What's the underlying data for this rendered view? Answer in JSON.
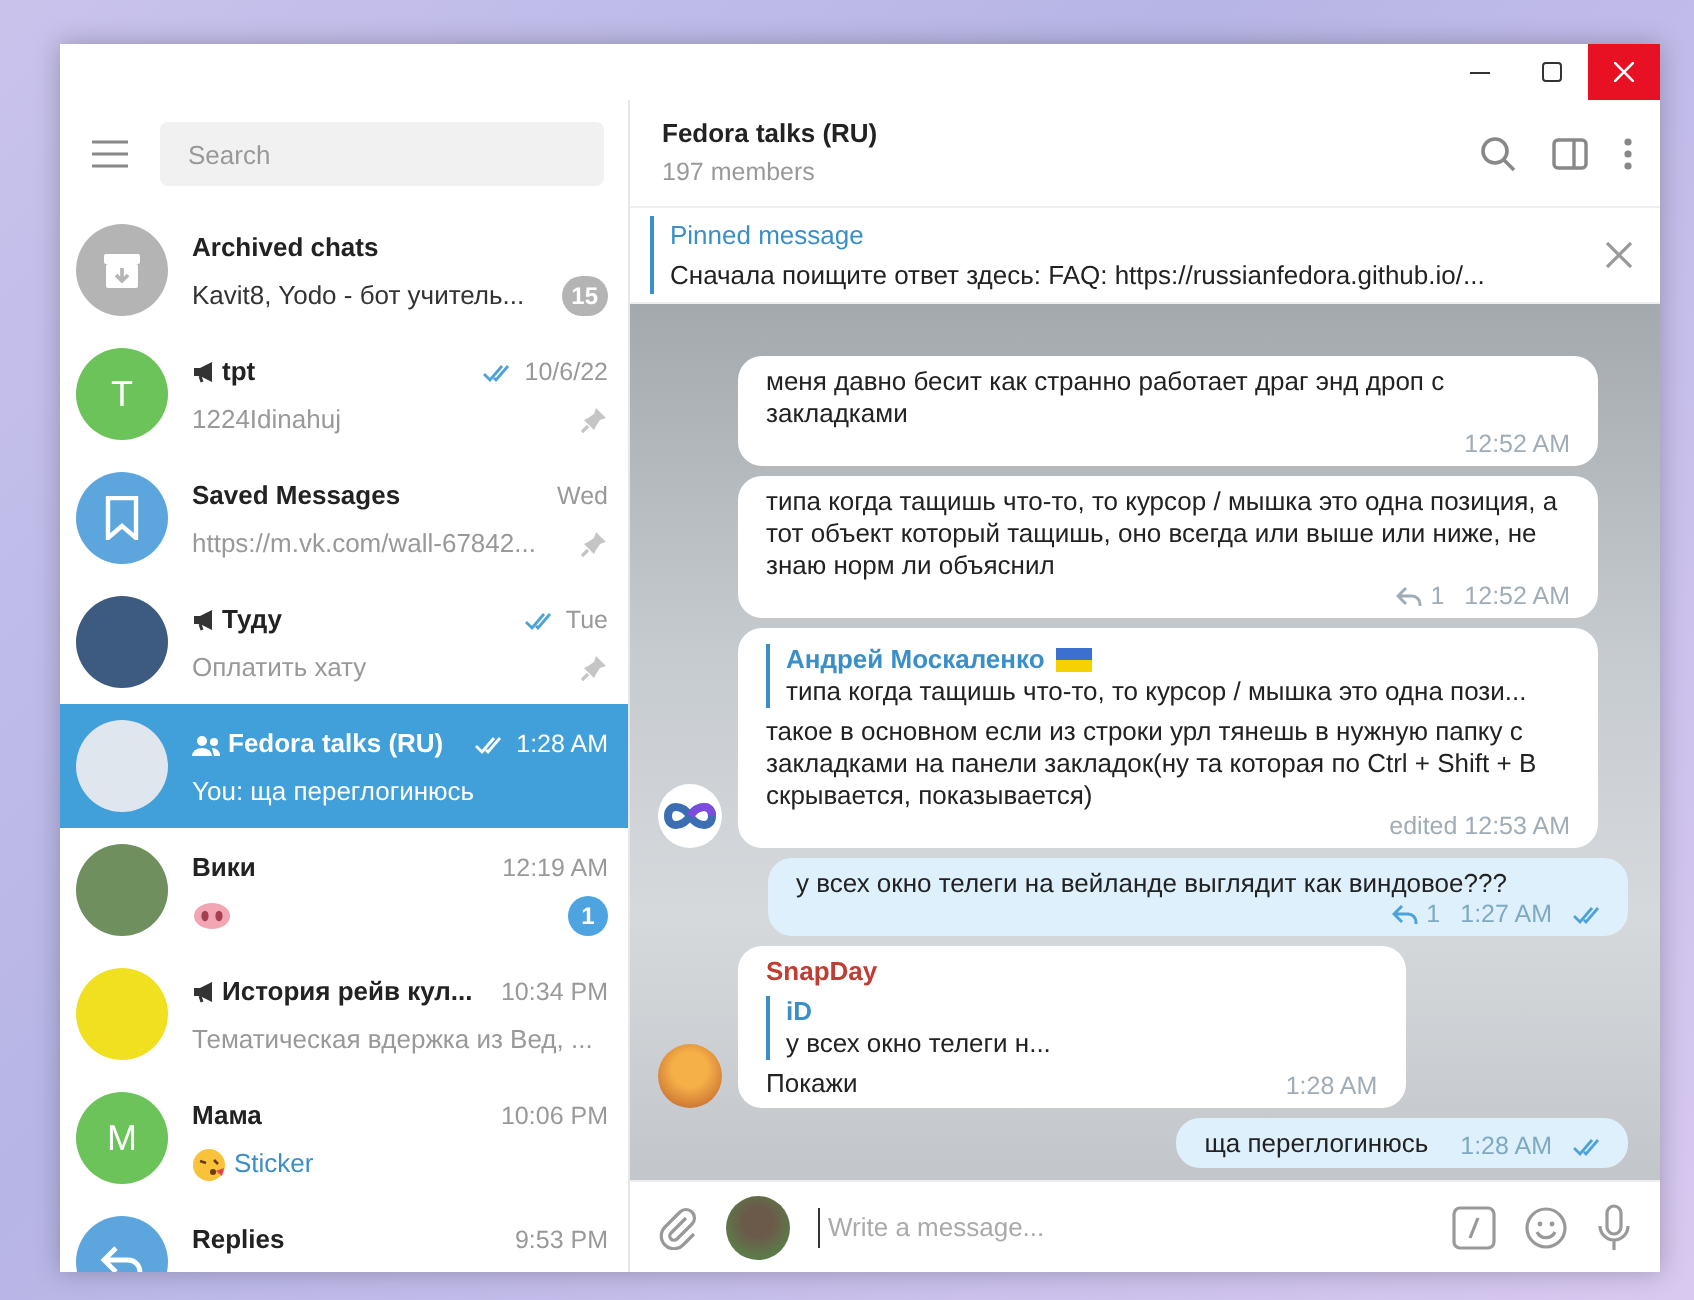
{
  "sidebar": {
    "search": {
      "placeholder": "Search"
    },
    "chats": [
      {
        "kind": "archive",
        "name": "Archived chats",
        "preview": "Kavit8, Yodo - бот учитель...",
        "badge": "15",
        "badge_muted": true,
        "selected": false
      },
      {
        "kind": "letter",
        "avatar_letter": "T",
        "color": "#6cc35a",
        "channel": true,
        "name": "tpt",
        "time": "10/6/22",
        "read": true,
        "preview": "1224Idinahuj",
        "pinned": true,
        "selected": false
      },
      {
        "kind": "saved",
        "color": "#5ca6dd",
        "name": "Saved Messages",
        "time": "Wed",
        "preview": "https://m.vk.com/wall-67842...",
        "pinned": true,
        "selected": false
      },
      {
        "kind": "photo",
        "color": "#3d5a80",
        "channel": true,
        "name": "Туду",
        "time": "Tue",
        "read": true,
        "preview": "Оплатить хату",
        "pinned": true,
        "selected": false
      },
      {
        "kind": "photo",
        "color": "#dfe6ee",
        "group": true,
        "name": "Fedora talks (RU)",
        "time": "1:28 AM",
        "read": true,
        "preview": "You: ща переглогинюсь",
        "selected": true
      },
      {
        "kind": "photo",
        "color": "#6f8f5e",
        "name": "Вики",
        "time": "12:19 AM",
        "preview_emoji": {
          "kind": "pig-nose"
        },
        "badge": "1",
        "badge_muted": false,
        "selected": false
      },
      {
        "kind": "photo",
        "color": "#f0e020",
        "channel": true,
        "name": "История рейв кул...",
        "time": "10:34 PM",
        "preview": "Тематическая вдержка из Вед, ...",
        "selected": false
      },
      {
        "kind": "letter",
        "avatar_letter": "M",
        "color": "#6cc35a",
        "name": "Мама",
        "time": "10:06 PM",
        "preview_emoji": {
          "kind": "kiss"
        },
        "preview": "Sticker",
        "preview_media": true,
        "selected": false
      },
      {
        "kind": "replies",
        "color": "#5ca6dd",
        "name": "Replies",
        "time": "9:53 PM",
        "selected": false
      }
    ]
  },
  "chat": {
    "title": "Fedora talks (RU)",
    "subtitle": "197 members",
    "pinned": {
      "label": "Pinned message",
      "text": "Сначала поищите ответ здесь: FAQ: https://russianfedora.github.io/..."
    },
    "messages": [
      {
        "kind": "in",
        "text": "меня давно бесит как странно работает драг энд дроп с закладками",
        "time": "12:52 AM"
      },
      {
        "kind": "in",
        "text": "типа когда тащишь что-то, то курсор / мышка это одна позиция, а тот объект который тащишь, оно всегда или выше или ниже, не знаю норм ли объяснил",
        "replies": "1",
        "time": "12:52 AM"
      },
      {
        "kind": "in",
        "avatar": {
          "kind": "infinity"
        },
        "reply": {
          "author": "Андрей Москаленко",
          "flag": true,
          "text": "типа когда тащишь что-то, то курсор / мышка это одна пози..."
        },
        "text": "такое в основном если из строки урл тянешь в нужную папку с закладками на панели закладок(ну та которая по Ctrl + Shift + B скрывается, показывается)",
        "time": "edited 12:53 AM"
      },
      {
        "kind": "out",
        "text": "у всех окно телеги на вейланде выглядит как виндовое???",
        "replies": "1",
        "time": "1:27 AM",
        "read": true
      },
      {
        "kind": "in",
        "avatar": {
          "kind": "photo"
        },
        "author": "SnapDay",
        "color": "#c03d33",
        "reply": {
          "author": "iD",
          "flag": false,
          "text": "у всех окно телеги н..."
        },
        "text": "Покажи",
        "time": "1:28 AM"
      },
      {
        "kind": "out",
        "text": "ща переглогинюсь",
        "time": "1:28 AM",
        "read": true
      }
    ],
    "composer": {
      "placeholder": "Write a message..."
    }
  }
}
